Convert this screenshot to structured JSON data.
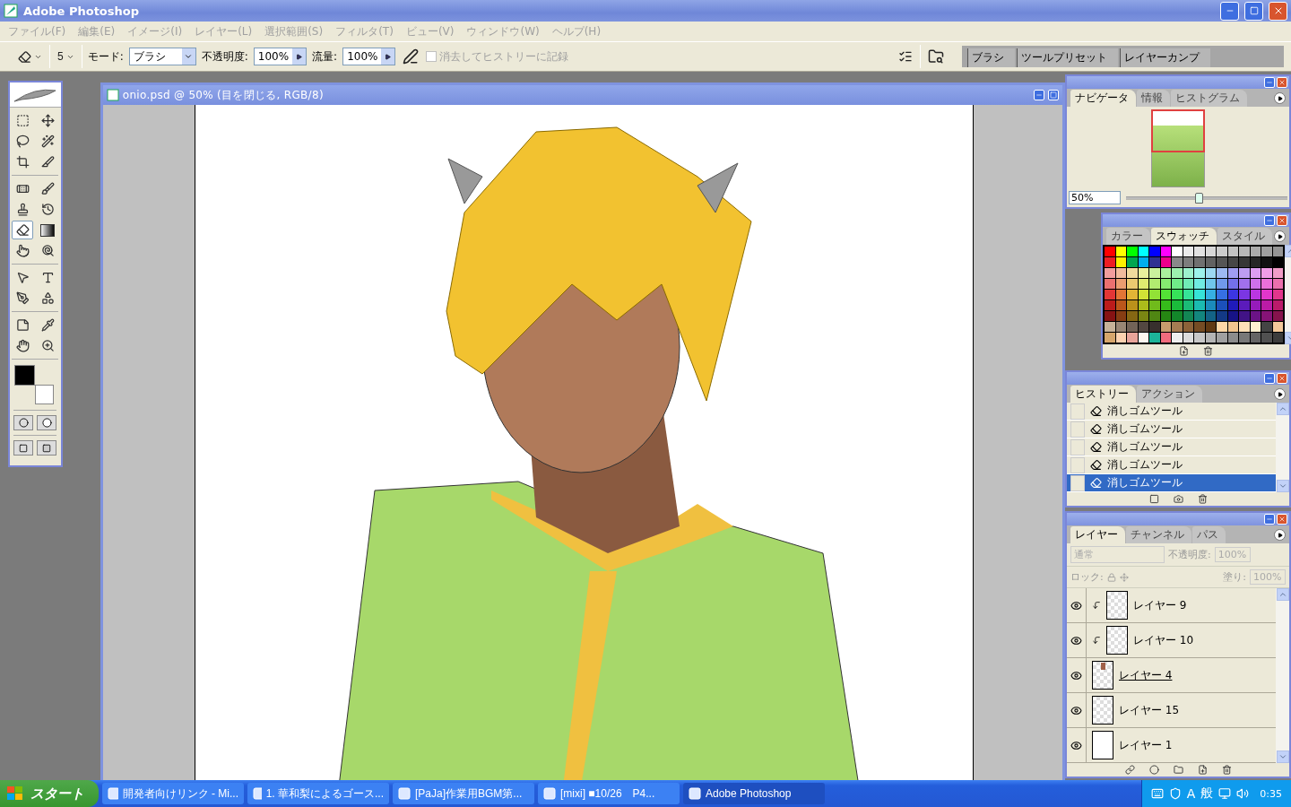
{
  "window": {
    "title": "Adobe Photoshop"
  },
  "menu": [
    "ファイル(F)",
    "編集(E)",
    "イメージ(I)",
    "レイヤー(L)",
    "選択範囲(S)",
    "フィルタ(T)",
    "ビュー(V)",
    "ウィンドウ(W)",
    "ヘルプ(H)"
  ],
  "options_bar": {
    "brush_size": "5",
    "mode_label": "モード:",
    "mode_value": "ブラシ",
    "opacity_label": "不透明度:",
    "opacity_value": "100%",
    "flow_label": "流量:",
    "flow_value": "100%",
    "erase_to_history": {
      "label": "消去してヒストリーに記録",
      "checked": false,
      "disabled": true
    }
  },
  "palette_well": [
    "ブラシ",
    "ツールプリセット",
    "レイヤーカンプ"
  ],
  "toolbox": {
    "tools": [
      {
        "kind": "marquee",
        "selected": false
      },
      {
        "kind": "move",
        "selected": false
      },
      {
        "kind": "lasso",
        "selected": false
      },
      {
        "kind": "magic-wand",
        "selected": false
      },
      {
        "kind": "crop",
        "selected": false
      },
      {
        "kind": "slice",
        "selected": false
      },
      {
        "kind": "healing",
        "selected": false
      },
      {
        "kind": "brush",
        "selected": false
      },
      {
        "kind": "stamp",
        "selected": false
      },
      {
        "kind": "history-brush",
        "selected": false
      },
      {
        "kind": "eraser",
        "selected": true
      },
      {
        "kind": "gradient",
        "selected": false
      },
      {
        "kind": "smudge",
        "selected": false
      },
      {
        "kind": "dodge",
        "selected": false
      },
      {
        "kind": "path-select",
        "selected": false
      },
      {
        "kind": "type",
        "selected": false
      },
      {
        "kind": "pen",
        "selected": false
      },
      {
        "kind": "shape",
        "selected": false
      },
      {
        "kind": "notes",
        "selected": false
      },
      {
        "kind": "eyedropper",
        "selected": false
      },
      {
        "kind": "hand",
        "selected": false
      },
      {
        "kind": "zoom",
        "selected": false
      }
    ]
  },
  "document": {
    "title": "onio.psd @ 50% (目を閉じる, RGB/8)"
  },
  "navigator": {
    "tabs": [
      {
        "label": "ナビゲータ",
        "selected": true
      },
      {
        "label": "情報",
        "selected": false
      },
      {
        "label": "ヒストグラム",
        "selected": false
      }
    ],
    "zoom": "50%",
    "level": 0.45
  },
  "swatches": {
    "tabs": [
      {
        "label": "カラー",
        "selected": false
      },
      {
        "label": "スウォッチ",
        "selected": true
      },
      {
        "label": "スタイル",
        "selected": false
      }
    ]
  },
  "history": {
    "tabs": [
      {
        "label": "ヒストリー",
        "selected": true
      },
      {
        "label": "アクション",
        "selected": false
      }
    ],
    "items": [
      {
        "label": "消しゴムツール",
        "selected": false
      },
      {
        "label": "消しゴムツール",
        "selected": false
      },
      {
        "label": "消しゴムツール",
        "selected": false
      },
      {
        "label": "消しゴムツール",
        "selected": false
      },
      {
        "label": "消しゴムツール",
        "selected": true
      }
    ]
  },
  "layers": {
    "tabs": [
      {
        "label": "レイヤー",
        "selected": true
      },
      {
        "label": "チャンネル",
        "selected": false
      },
      {
        "label": "パス",
        "selected": false
      }
    ],
    "blend_mode": "通常",
    "opacity_label": "不透明度:",
    "opacity_value": "100%",
    "lock_label": "ロック:",
    "fill_label": "塗り:",
    "fill_value": "100%",
    "rows": [
      {
        "name": "レイヤー 9",
        "visible": true,
        "clipped": true,
        "underlined": false,
        "kind": "transparent"
      },
      {
        "name": "レイヤー 10",
        "visible": true,
        "clipped": true,
        "underlined": false,
        "kind": "transparent"
      },
      {
        "name": "レイヤー 4",
        "visible": true,
        "clipped": false,
        "underlined": true,
        "kind": "figure"
      },
      {
        "name": "レイヤー 15",
        "visible": true,
        "clipped": false,
        "underlined": false,
        "kind": "transparent"
      },
      {
        "name": "レイヤー 1",
        "visible": true,
        "clipped": false,
        "underlined": false,
        "kind": "white"
      }
    ]
  },
  "taskbar": {
    "start": "スタート",
    "tasks": [
      {
        "label": "開発者向けリンク - Mi...",
        "selected": false
      },
      {
        "label": "1. 華和梨によるゴース...",
        "selected": false
      },
      {
        "label": "[PaJa]作業用BGM第...",
        "selected": false
      },
      {
        "label": "[mixi] ■10/26　P4...",
        "selected": false
      },
      {
        "label": "Adobe Photoshop",
        "selected": true
      }
    ],
    "tray_texts": [
      "A",
      "般"
    ],
    "clock": "0:35"
  }
}
